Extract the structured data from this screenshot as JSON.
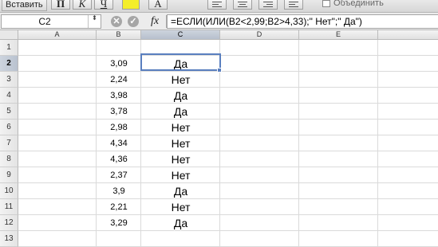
{
  "toolbar": {
    "paste_label": "Вставить",
    "bold_label": "П",
    "italic_label": "К",
    "underline_label": "Ч",
    "font_color_label": "A",
    "merge_label": "Объединить",
    "fill_color": "#f4ee2a"
  },
  "formula_bar": {
    "name_box": "C2",
    "stepper_glyph": "⬍",
    "cancel_glyph": "✕",
    "confirm_glyph": "✓",
    "fx_label": "fx",
    "formula": "=ЕСЛИ(ИЛИ(B2<2,99;B2>4,33);\" Нет\";\" Да\")"
  },
  "grid": {
    "columns": [
      "A",
      "B",
      "C",
      "D",
      "E"
    ],
    "selected_column": "C",
    "selected_row": "2",
    "rows": [
      {
        "row": "1",
        "b": "",
        "c": ""
      },
      {
        "row": "2",
        "b": "3,09",
        "c": "Да"
      },
      {
        "row": "3",
        "b": "2,24",
        "c": "Нет"
      },
      {
        "row": "4",
        "b": "3,98",
        "c": "Да"
      },
      {
        "row": "5",
        "b": "3,78",
        "c": "Да"
      },
      {
        "row": "6",
        "b": "2,98",
        "c": "Нет"
      },
      {
        "row": "7",
        "b": "4,34",
        "c": "Нет"
      },
      {
        "row": "8",
        "b": "4,36",
        "c": "Нет"
      },
      {
        "row": "9",
        "b": "2,37",
        "c": "Нет"
      },
      {
        "row": "10",
        "b": "3,9",
        "c": "Да"
      },
      {
        "row": "11",
        "b": "2,21",
        "c": "Нет"
      },
      {
        "row": "12",
        "b": "3,29",
        "c": "Да"
      },
      {
        "row": "13",
        "b": "",
        "c": ""
      }
    ],
    "selection_color": "#5a7fbf"
  }
}
